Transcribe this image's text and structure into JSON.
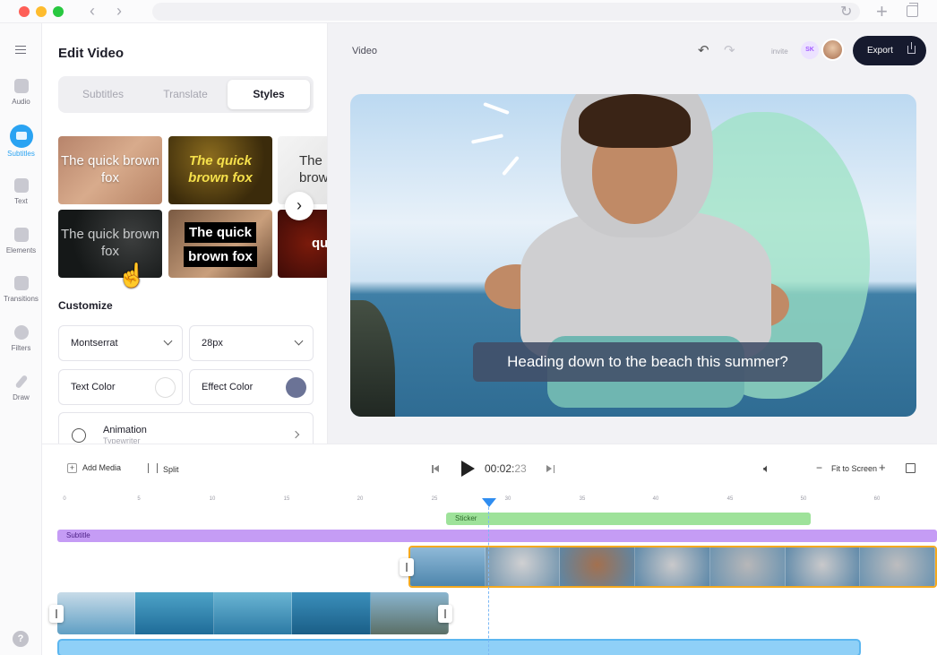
{
  "browser": {
    "back": "‹",
    "forward": "›",
    "reload": "↻",
    "new_tab": "+"
  },
  "rail": {
    "items": [
      {
        "label": "Audio"
      },
      {
        "label": "Subtitles",
        "active": true
      },
      {
        "label": "Text"
      },
      {
        "label": "Elements"
      },
      {
        "label": "Transitions"
      },
      {
        "label": "Filters"
      },
      {
        "label": "Draw"
      }
    ],
    "help": "?",
    "accent": "#2aa3f2"
  },
  "panel": {
    "title": "Edit Video",
    "tabs": [
      "Subtitles",
      "Translate",
      "Styles"
    ],
    "active_tab": "Styles",
    "style_sample_text": "The quick brown fox",
    "style_sample_line1": "The quick",
    "style_sample_line2": "brown fox",
    "style_sample_partial_1": "The",
    "style_sample_partial_2": "brow",
    "style_sample_partial_3": "qu",
    "customize_label": "Customize",
    "font": "Montserrat",
    "size": "28px",
    "text_color_label": "Text Color",
    "text_color": "#ffffff",
    "effect_color_label": "Effect Color",
    "effect_color": "#6b7396",
    "animation_label": "Animation",
    "animation_value": "Typewriter"
  },
  "preview": {
    "label": "Video",
    "invite": "invite",
    "user_initials": "SK",
    "export_label": "Export",
    "caption": "Heading down to the beach this summer?"
  },
  "timeline": {
    "add_media": "Add Media",
    "split": "Split",
    "time_main": "00:02:",
    "time_frames": "23",
    "zoom_label": "Fit to Screen",
    "ruler_ticks": [
      "0",
      "5",
      "10",
      "15",
      "20",
      "25",
      "30",
      "35",
      "40",
      "45",
      "50",
      "60"
    ],
    "sticker_label": "Sticker",
    "subtitle_label": "Subtitle",
    "sticker_color": "#9ee29a",
    "subtitle_color": "#c59cf5",
    "selected_clip_border": "#f4a91f"
  }
}
